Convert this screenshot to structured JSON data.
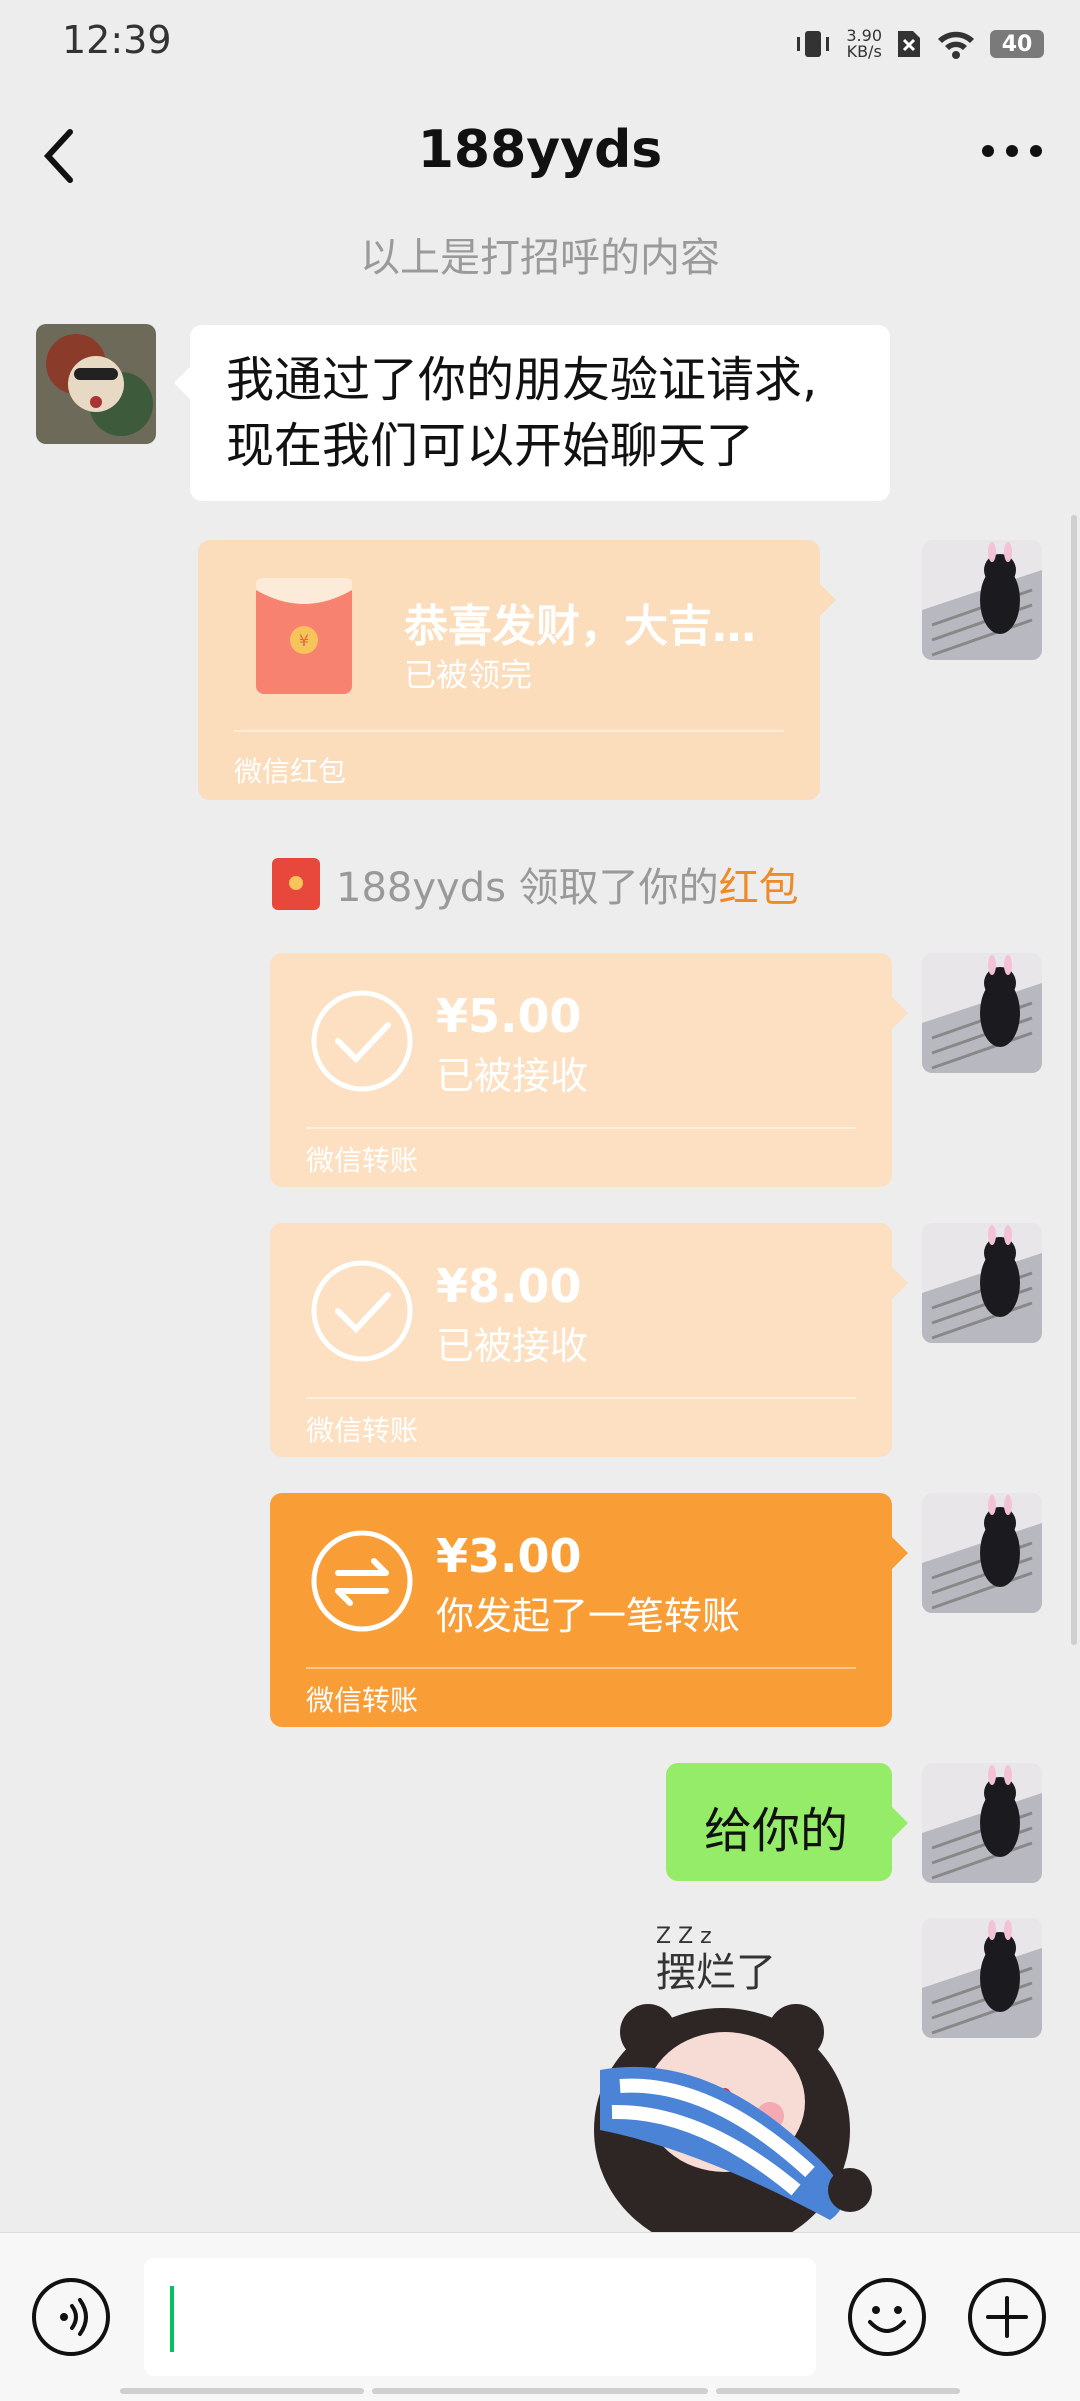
{
  "status_bar": {
    "time": "12:39",
    "speed_value": "3.90",
    "speed_unit": "KB/s",
    "battery": "40"
  },
  "nav": {
    "title": "188yyds"
  },
  "system_message": "以上是打招呼的内容",
  "messages": {
    "friend_text": {
      "line1": "我通过了你的朋友验证请求,",
      "line2": "现在我们可以开始聊天了"
    },
    "red_packet": {
      "title": "恭喜发财，大吉…",
      "status": "已被领完",
      "footer": "微信红包"
    },
    "red_packet_notice": {
      "prefix": "188yyds 领取了你的",
      "highlight": "红包"
    },
    "transfer_1": {
      "amount": "¥5.00",
      "status": "已被接收",
      "footer": "微信转账"
    },
    "transfer_2": {
      "amount": "¥8.00",
      "status": "已被接收",
      "footer": "微信转账"
    },
    "transfer_3": {
      "amount": "¥3.00",
      "status": "你发起了一笔转账",
      "footer": "微信转账"
    },
    "text_self": "给你的",
    "sticker": {
      "caption": "摆烂了",
      "zzz": "Z Z z"
    }
  },
  "colors": {
    "chat_bg": "#EDEDED",
    "self_bubble": "#95EC69",
    "transfer_active": "#F99E37",
    "transfer_done": "#FCE0C1",
    "cursor": "#07C160"
  },
  "icons": {
    "back": "chevron-left-icon",
    "more": "more-dots-icon",
    "voice": "voice-icon",
    "emoji": "emoji-icon",
    "plus": "plus-icon"
  }
}
